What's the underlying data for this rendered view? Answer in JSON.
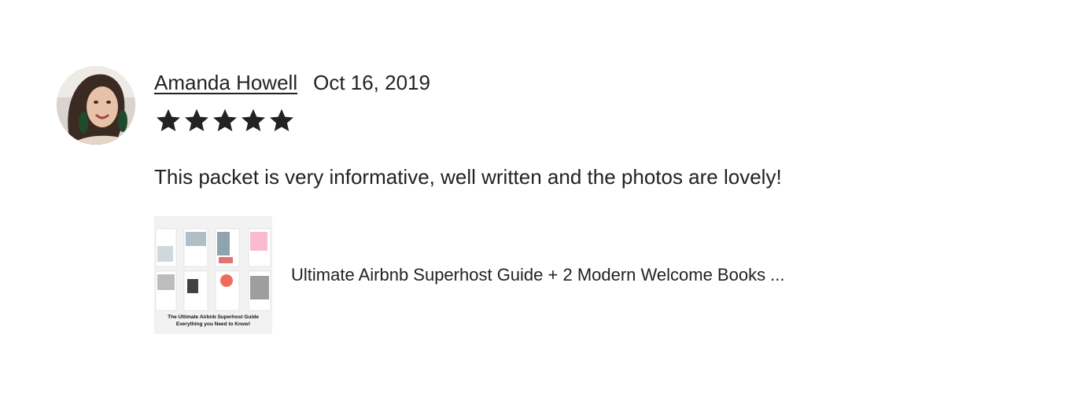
{
  "review": {
    "reviewer_name": "Amanda Howell",
    "date": "Oct 16, 2019",
    "rating": 5,
    "rating_max": 5,
    "text": "This packet is very informative, well written and the photos are lovely!",
    "avatar_icon": "avatar-photo",
    "star_color": "#222222"
  },
  "listing": {
    "title": "Ultimate Airbnb Superhost Guide + 2 Modern Welcome Books ...",
    "thumbnail": {
      "caption_line1": "The Ultimate Airbnb Superhost Guide",
      "caption_line2": "Everything you Need to Know!"
    }
  }
}
